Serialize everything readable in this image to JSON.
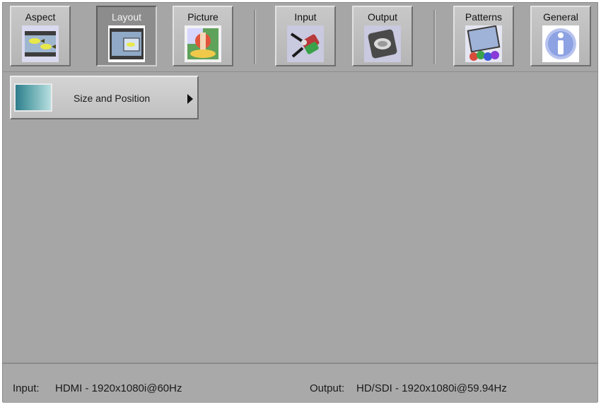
{
  "toolbar": {
    "aspect": "Aspect",
    "layout": "Layout",
    "picture": "Picture",
    "input": "Input",
    "output": "Output",
    "patterns": "Patterns",
    "general": "General",
    "active": "Layout"
  },
  "menu": {
    "items": [
      {
        "label": "Size and Position"
      }
    ]
  },
  "status": {
    "input_label": "Input:",
    "input_value": "HDMI - 1920x1080i@60Hz",
    "output_label": "Output:",
    "output_value": "HD/SDI - 1920x1080i@59.94Hz"
  }
}
